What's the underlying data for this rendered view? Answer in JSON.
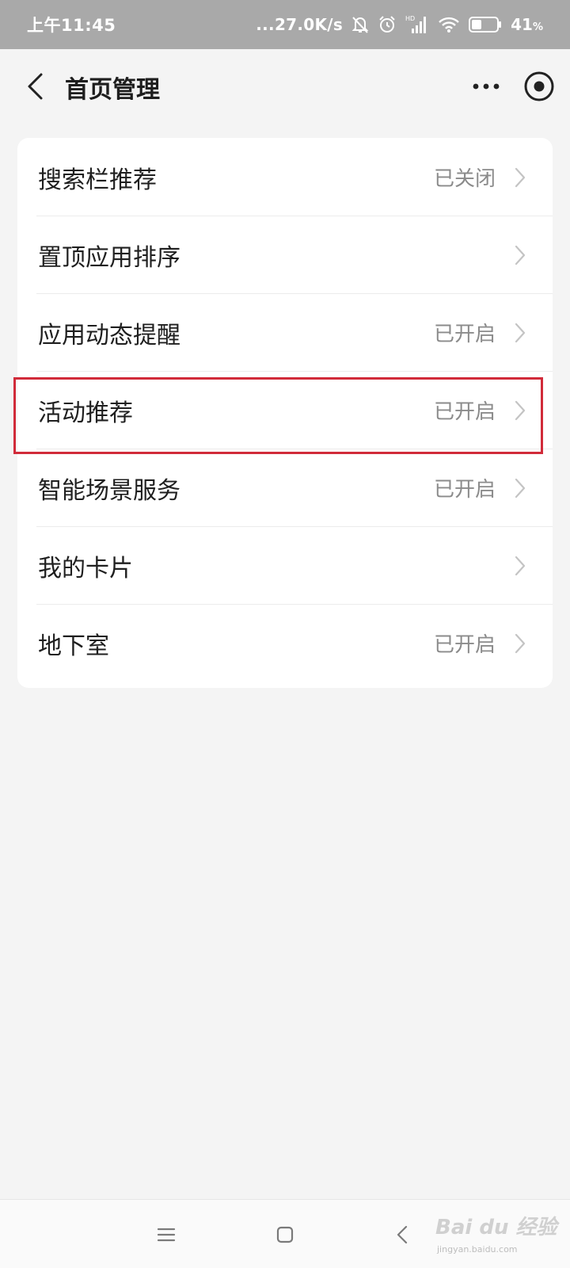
{
  "status_bar": {
    "time": "上午11:45",
    "network_speed": "...27.0K/s",
    "hd_label": "HD",
    "battery_percent": "41",
    "battery_unit": "%",
    "battery_level": 0.41
  },
  "nav": {
    "title": "首页管理",
    "icons": [
      "back-icon",
      "more-icon",
      "mini-program-target-icon"
    ]
  },
  "settings": {
    "items": [
      {
        "label": "搜索栏推荐",
        "value": "已关闭"
      },
      {
        "label": "置顶应用排序",
        "value": ""
      },
      {
        "label": "应用动态提醒",
        "value": "已开启"
      },
      {
        "label": "活动推荐",
        "value": "已开启"
      },
      {
        "label": "智能场景服务",
        "value": "已开启"
      },
      {
        "label": "我的卡片",
        "value": ""
      },
      {
        "label": "地下室",
        "value": "已开启"
      }
    ],
    "highlighted_item": "活动推荐"
  },
  "colors": {
    "status_bar_bg": "#a9a9a9",
    "page_bg": "#f4f4f4",
    "card_bg": "#ffffff",
    "highlight_border": "#d12b3a",
    "value_text": "#8b8b8b"
  },
  "watermark": {
    "main": "Bai du 经验",
    "sub": "jingyan.baidu.com"
  }
}
